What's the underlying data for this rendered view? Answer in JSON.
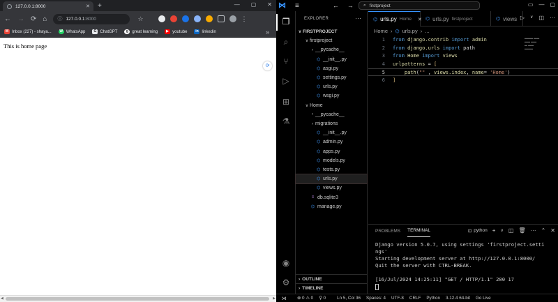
{
  "browser": {
    "tab_title": "127.0.0.1:8000",
    "tab_close": "✕",
    "new_tab": "+",
    "window_controls": [
      "—",
      "▢",
      "✕"
    ],
    "nav": {
      "back": "←",
      "forward": "→",
      "reload": "⟳",
      "home": "⌂"
    },
    "address": {
      "host": "127.0.0.1",
      "port": ":8000"
    },
    "bookmarks": [
      {
        "label": "Inbox (227) - shaya...",
        "icon": "M",
        "color": "#ea4335"
      },
      {
        "label": "WhatsApp",
        "icon": "W",
        "color": "#25d366"
      },
      {
        "label": "ChatGPT",
        "icon": "G",
        "color": "#e8eaed"
      },
      {
        "label": "great learning",
        "icon": "g",
        "color": "#ffffff"
      },
      {
        "label": "youtube",
        "icon": "▶",
        "color": "#ff0000"
      },
      {
        "label": "linkedin",
        "icon": "in",
        "color": "#0a66c2"
      }
    ],
    "bookmarks_more": "»",
    "page_text": "This is home page"
  },
  "vscode": {
    "search_text": "firstproject",
    "explorer_label": "EXPLORER",
    "tree": [
      {
        "label": "FIRSTPROJECT",
        "type": "root",
        "indent": 0,
        "twisty": "∨"
      },
      {
        "label": "firstproject",
        "type": "folder",
        "indent": 1,
        "twisty": "∨"
      },
      {
        "label": "__pycache__",
        "type": "folder",
        "indent": 2,
        "twisty": "›"
      },
      {
        "label": "__init__.py",
        "type": "py",
        "indent": 2
      },
      {
        "label": "asgi.py",
        "type": "py",
        "indent": 2
      },
      {
        "label": "settings.py",
        "type": "py",
        "indent": 2
      },
      {
        "label": "urls.py",
        "type": "py",
        "indent": 2
      },
      {
        "label": "wsgi.py",
        "type": "py",
        "indent": 2
      },
      {
        "label": "Home",
        "type": "folder",
        "indent": 1,
        "twisty": "∨"
      },
      {
        "label": "__pycache__",
        "type": "folder",
        "indent": 2,
        "twisty": "›"
      },
      {
        "label": "migrations",
        "type": "folder",
        "indent": 2,
        "twisty": "›"
      },
      {
        "label": "__init__.py",
        "type": "py",
        "indent": 2
      },
      {
        "label": "admin.py",
        "type": "py",
        "indent": 2
      },
      {
        "label": "apps.py",
        "type": "py",
        "indent": 2
      },
      {
        "label": "models.py",
        "type": "py",
        "indent": 2
      },
      {
        "label": "tests.py",
        "type": "py",
        "indent": 2
      },
      {
        "label": "urls.py",
        "type": "py",
        "indent": 2,
        "selected": true
      },
      {
        "label": "views.py",
        "type": "py",
        "indent": 2
      },
      {
        "label": "db.sqlite3",
        "type": "db",
        "indent": 1
      },
      {
        "label": "manage.py",
        "type": "py",
        "indent": 1
      }
    ],
    "outline_label": "OUTLINE",
    "timeline_label": "TIMELINE",
    "tabs": [
      {
        "label": "urls.py",
        "desc": "Home",
        "active": true
      },
      {
        "label": "urls.py",
        "desc": "firstproject",
        "active": false
      },
      {
        "label": "views",
        "desc": "",
        "active": false
      }
    ],
    "breadcrumb": [
      "Home",
      "urls.py",
      "..."
    ],
    "code_lines": [
      {
        "n": "1",
        "html": "<span class=\"kw\">from</span> <span class=\"fn\">django.contrib</span> <span class=\"kw\">import</span> <span class=\"fn\">admin</span>"
      },
      {
        "n": "2",
        "html": "<span class=\"kw\">from</span> <span class=\"fn\">django.urls</span> <span class=\"kw\">import</span> path"
      },
      {
        "n": "3",
        "html": "<span class=\"kw\">from</span> <span class=\"fn\">Home</span> <span class=\"kw\">import</span> <span class=\"fn\">views</span>"
      },
      {
        "n": "4",
        "html": "<span class=\"fn\">urlpatterns</span> = <span class=\"br\">[</span>"
      },
      {
        "n": "5",
        "html": "    <span class=\"fn\">path</span>(<span class=\"str\">\"\"</span> , <span class=\"fn\">views.index</span>, <span class=\"fn\">name</span>= <span class=\"str\">'Home'</span>)"
      },
      {
        "n": "6",
        "html": "<span class=\"br\">]</span>"
      }
    ],
    "panel_tabs": [
      "PROBLEMS",
      "TERMINAL"
    ],
    "shell": "python",
    "terminal_lines": [
      "Django version 5.0.7, using settings 'firstproject.setti",
      "ngs'",
      "Starting development server at http://127.0.0.1:8000/",
      "Quit the server with CTRL-BREAK.",
      "",
      "[16/Jul/2024 14:25:11] \"GET / HTTP/1.1\" 200 17"
    ],
    "status": {
      "errors": "⊗ 0 ⚠ 0",
      "ports": "⚲ 0",
      "position": "Ln 5, Col 36",
      "spaces": "Spaces: 4",
      "encoding": "UTF-8",
      "eol": "CRLF",
      "language": "Python",
      "interpreter": "3.12.4 64-bit",
      "golive": "Go Live"
    }
  }
}
